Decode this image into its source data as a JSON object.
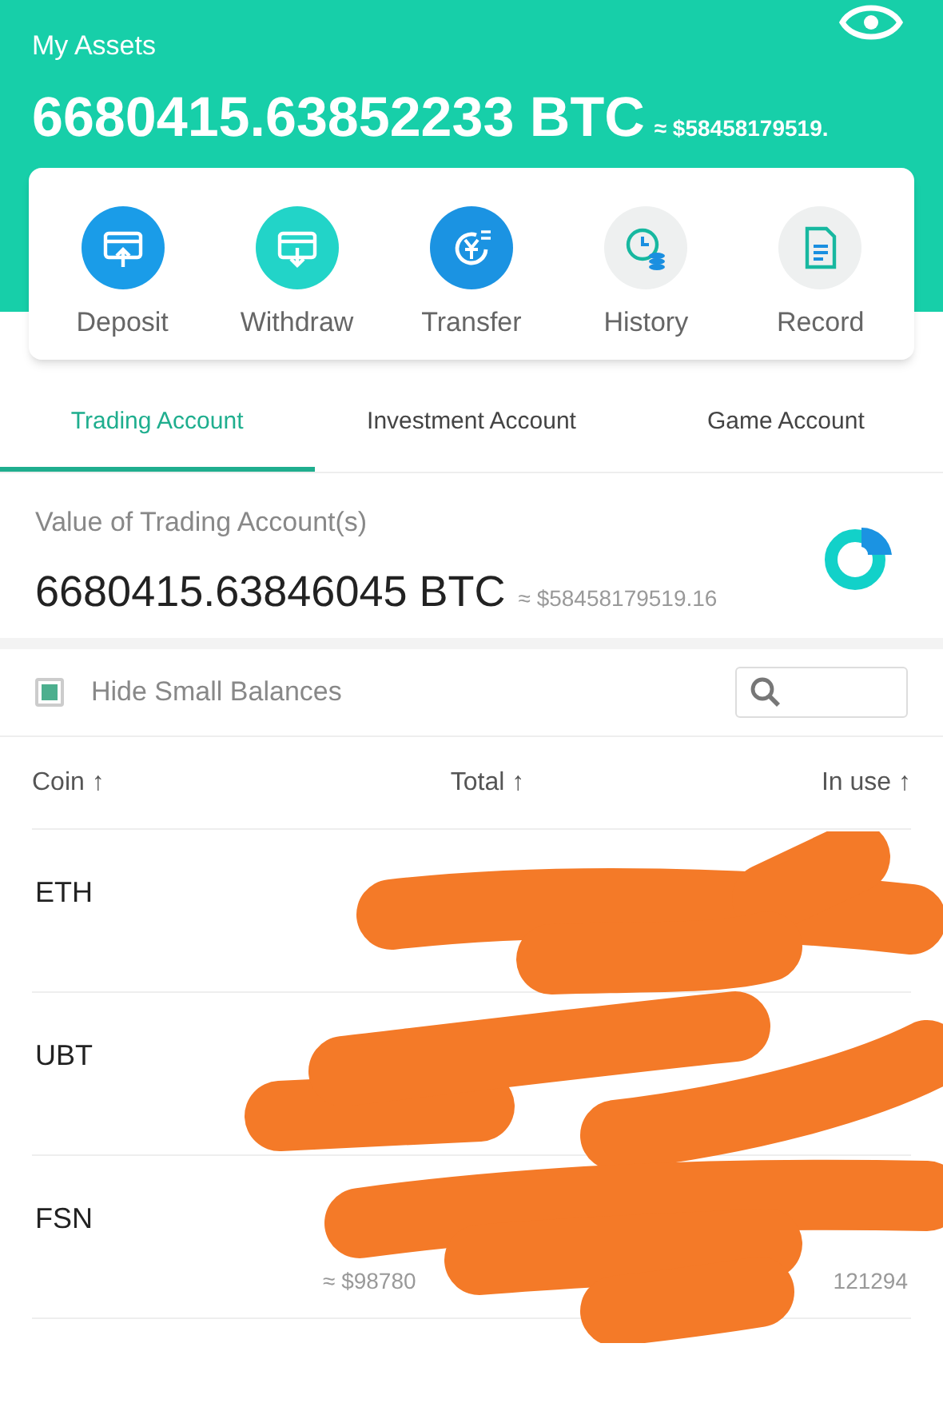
{
  "header": {
    "title": "My Assets",
    "amount": "6680415.63852233 BTC",
    "usd": "≈ $58458179519."
  },
  "actions": [
    {
      "label": "Deposit"
    },
    {
      "label": "Withdraw"
    },
    {
      "label": "Transfer"
    },
    {
      "label": "History"
    },
    {
      "label": "Record"
    }
  ],
  "tabs": [
    {
      "label": "Trading Account",
      "selected": true
    },
    {
      "label": "Investment Account",
      "selected": false
    },
    {
      "label": "Game Account",
      "selected": false
    }
  ],
  "summary": {
    "label": "Value of Trading Account(s)",
    "amount": "6680415.63846045 BTC",
    "usd": "≈ $58458179519.16"
  },
  "filter": {
    "label": "Hide Small Balances",
    "checked": true
  },
  "columns": [
    "Coin ↑",
    "Total ↑",
    "In use ↑"
  ],
  "rows": [
    {
      "coin": "ETH"
    },
    {
      "coin": "UBT"
    },
    {
      "coin": "FSN",
      "total_usd": "≈ $98780",
      "in_use_usd": "121294"
    }
  ]
}
